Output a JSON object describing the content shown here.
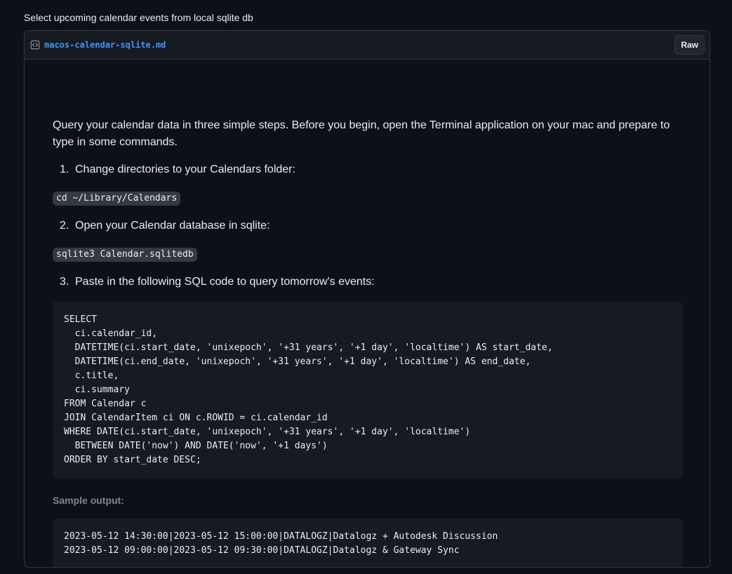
{
  "gist": {
    "description": "Select upcoming calendar events from local sqlite db"
  },
  "file": {
    "name": "macos-calendar-sqlite.md",
    "icon": "code-file-icon",
    "raw_label": "Raw"
  },
  "content": {
    "intro": "Query your calendar data in three simple steps. Before you begin, open the Terminal application on your mac and prepare to type in some commands.",
    "steps": [
      {
        "number": "1.",
        "text": "Change directories to your Calendars folder:",
        "code": "cd ~/Library/Calendars"
      },
      {
        "number": "2.",
        "text": "Open your Calendar database in sqlite:",
        "code": "sqlite3 Calendar.sqlitedb"
      },
      {
        "number": "3.",
        "text": "Paste in the following SQL code to query tomorrow's events:"
      }
    ],
    "sql_lines": [
      "SELECT",
      "  ci.calendar_id,",
      "  DATETIME(ci.start_date, 'unixepoch', '+31 years', '+1 day', 'localtime') AS start_date,",
      "  DATETIME(ci.end_date, 'unixepoch', '+31 years', '+1 day', 'localtime') AS end_date,",
      "  c.title,",
      "  ci.summary",
      "FROM Calendar c",
      "JOIN CalendarItem ci ON c.ROWID = ci.calendar_id",
      "WHERE DATE(ci.start_date, 'unixepoch', '+31 years', '+1 day', 'localtime')",
      "  BETWEEN DATE('now') AND DATE('now', '+1 days')",
      "ORDER BY start_date DESC;"
    ],
    "sample_label": "Sample output:",
    "sample_lines": [
      "2023-05-12 14:30:00|2023-05-12 15:00:00|DATALOGZ|Datalogz + Autodesk Discussion",
      "2023-05-12 09:00:00|2023-05-12 09:30:00|DATALOGZ|Datalogz & Gateway Sync"
    ]
  }
}
